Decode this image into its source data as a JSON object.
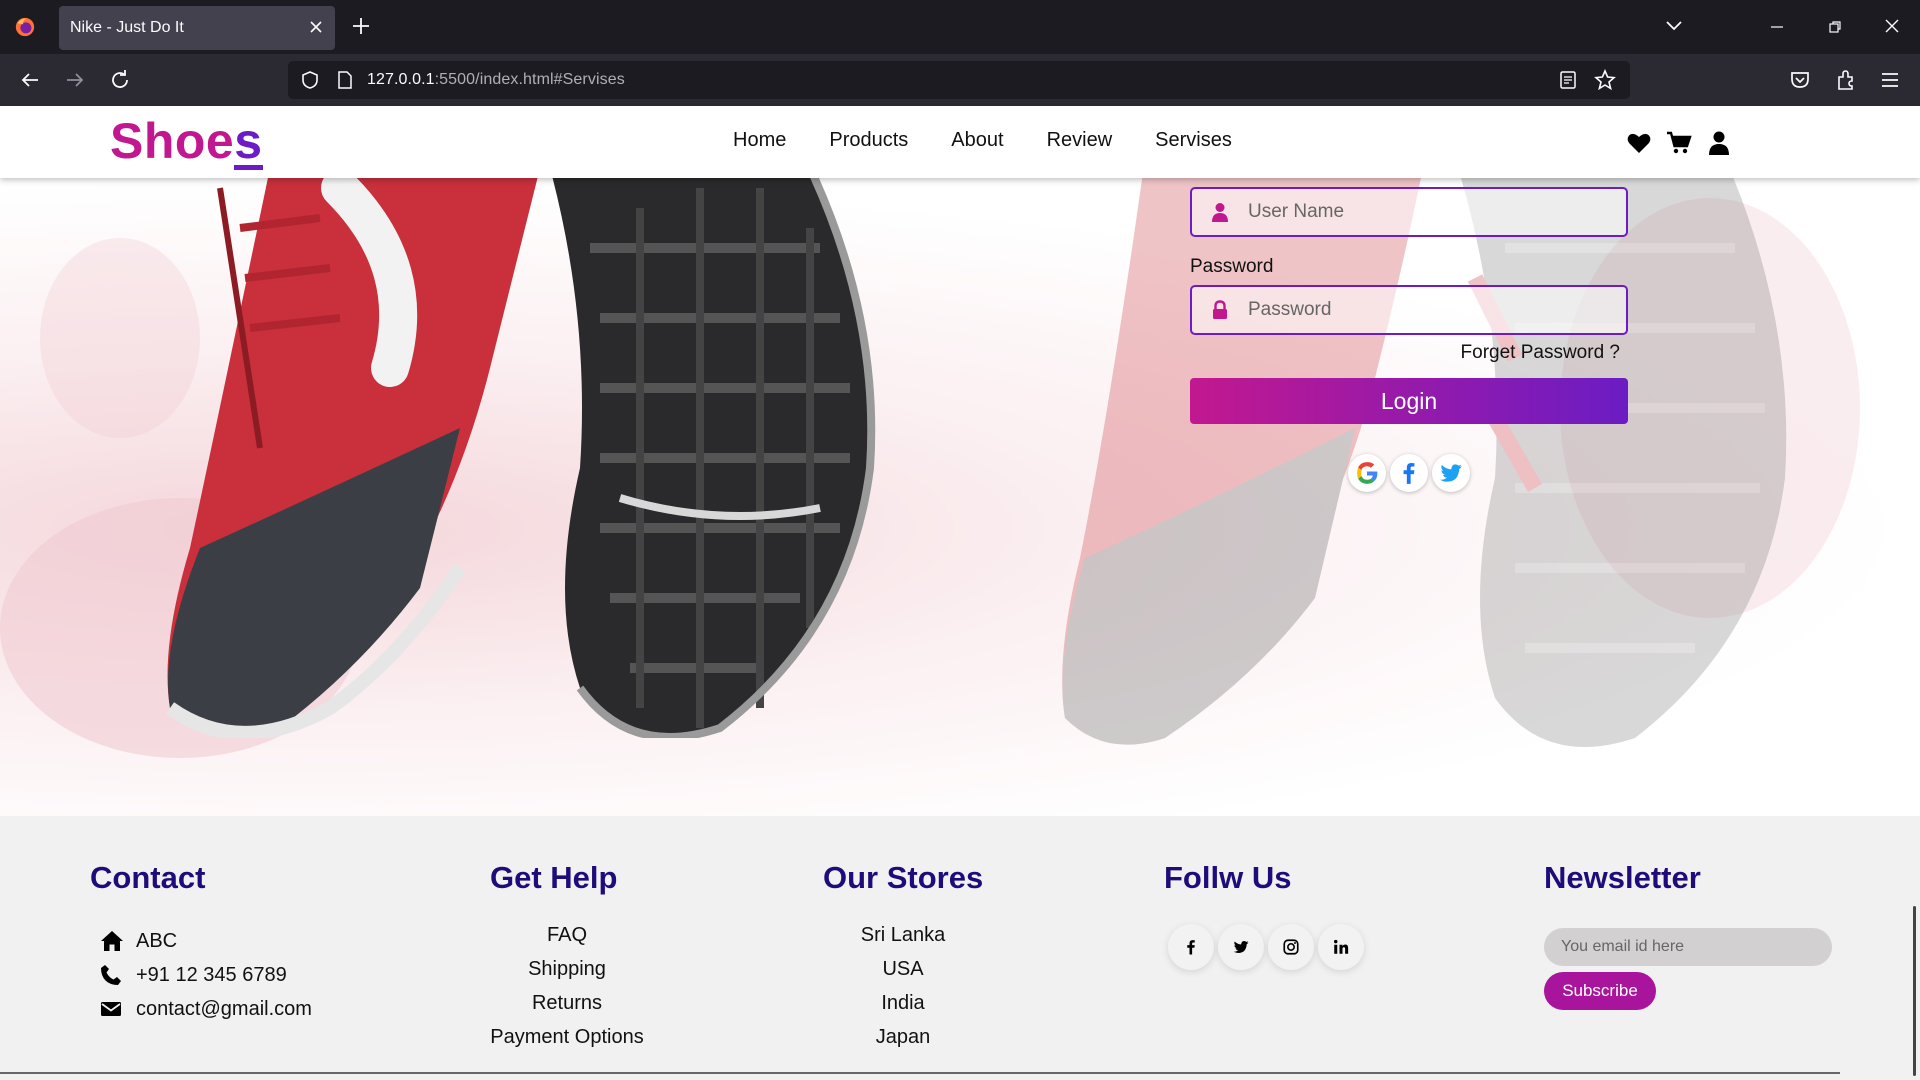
{
  "browser": {
    "tab_title": "Nike - Just Do It",
    "url_host": "127.0.0.1",
    "url_rest": ":5500/index.html#Servises"
  },
  "header": {
    "logo_main": "Shoe",
    "logo_last": "s",
    "menu": [
      "Home",
      "Products",
      "About",
      "Review",
      "Servises"
    ]
  },
  "login": {
    "username_placeholder": "User Name",
    "password_label": "Password",
    "password_placeholder": "Password",
    "forget_label": "Forget Password ?",
    "login_label": "Login"
  },
  "footer": {
    "contact": {
      "title": "Contact",
      "address": "ABC",
      "phone": "+91 12 345 6789",
      "email": "contact@gmail.com"
    },
    "help": {
      "title": "Get Help",
      "links": [
        "FAQ",
        "Shipping",
        "Returns",
        "Payment Options"
      ]
    },
    "stores": {
      "title": "Our Stores",
      "links": [
        "Sri Lanka",
        "USA",
        "India",
        "Japan"
      ]
    },
    "follow": {
      "title": "Follw Us"
    },
    "newsletter": {
      "title": "Newsletter",
      "placeholder": "You email id here",
      "button": "Subscribe"
    }
  },
  "colors": {
    "brand_pink": "#c2188f",
    "brand_purple": "#6b1cc4",
    "footer_heading": "#1f0c7a",
    "subscribe": "#a8149b"
  },
  "icons": [
    "firefox-icon",
    "back-icon",
    "forward-icon",
    "reload-icon",
    "shield-icon",
    "reader-icon",
    "star-icon",
    "pocket-icon",
    "extensions-icon",
    "menu-icon",
    "heart-icon",
    "cart-icon",
    "user-icon",
    "lock-icon",
    "google-icon",
    "facebook-icon",
    "twitter-icon",
    "instagram-icon",
    "linkedin-icon",
    "home-icon",
    "phone-icon",
    "mail-icon"
  ]
}
